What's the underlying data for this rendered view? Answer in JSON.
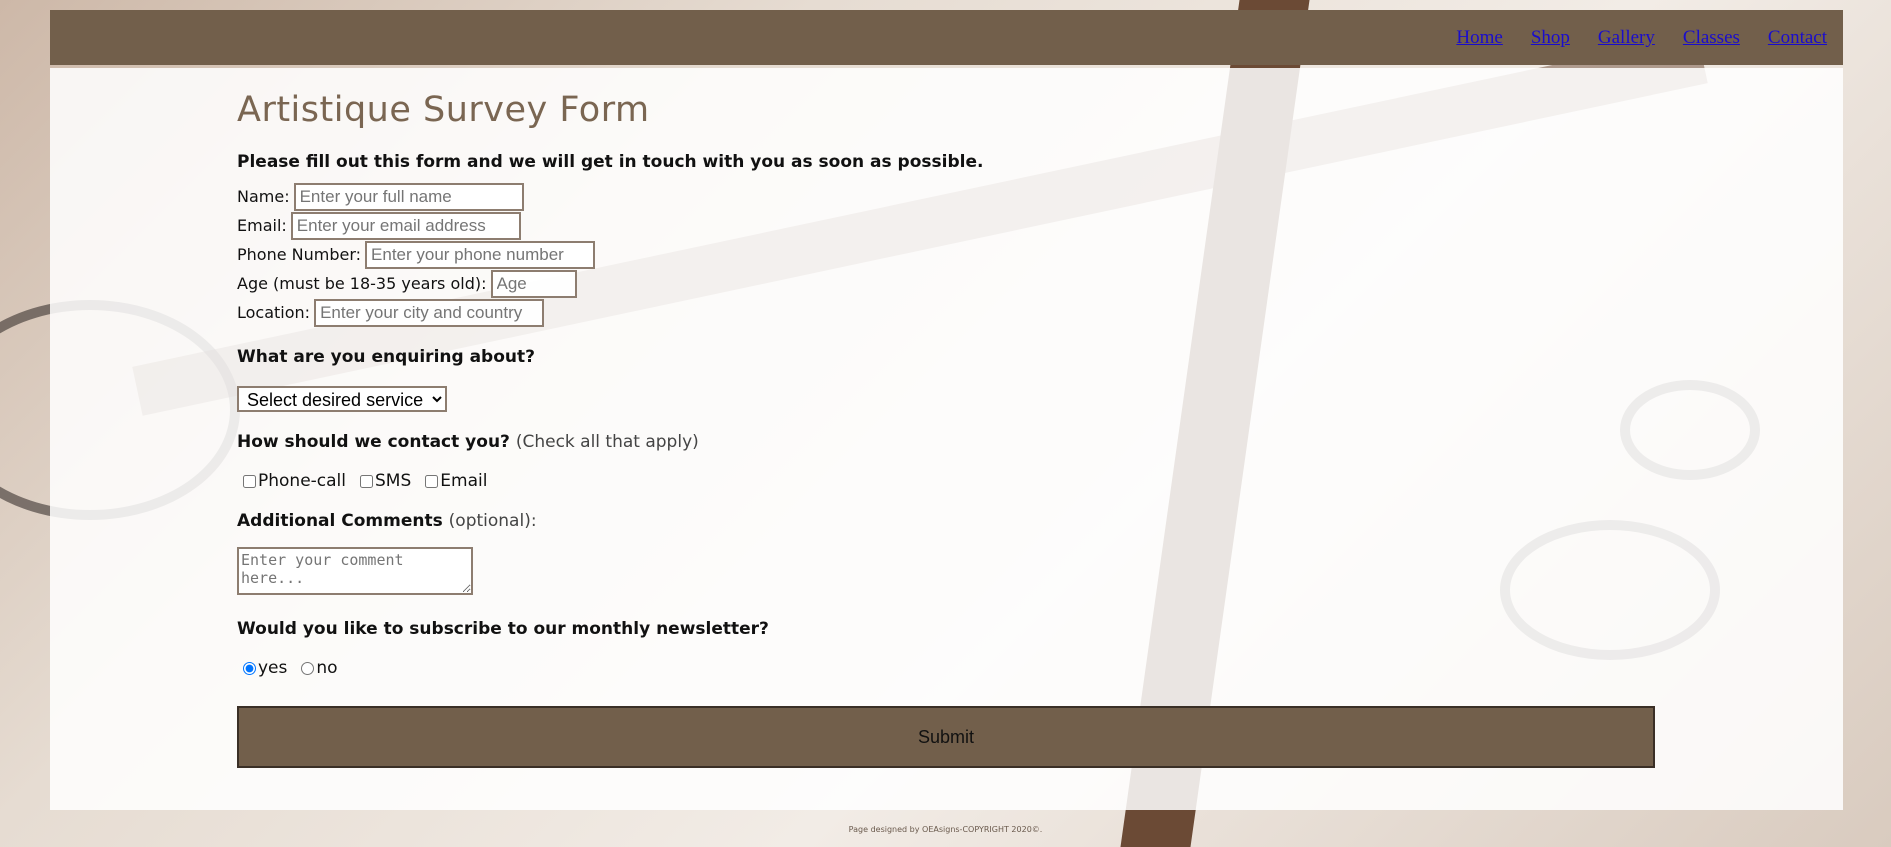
{
  "nav": {
    "items": [
      "Home",
      "Shop",
      "Gallery",
      "Classes",
      "Contact"
    ]
  },
  "form": {
    "title": "Artistique Survey Form",
    "intro": "Please fill out this form and we will get in touch with you as soon as possible.",
    "fields": [
      {
        "label": "Name:",
        "placeholder": "Enter your full name"
      },
      {
        "label": "Email:",
        "placeholder": "Enter your email address"
      },
      {
        "label": "Phone Number:",
        "placeholder": "Enter your phone number"
      },
      {
        "label": "Age (must be 18-35 years old):",
        "placeholder": "Age"
      },
      {
        "label": "Location:",
        "placeholder": "Enter your city and country"
      }
    ],
    "enquiry_question": "What are you enquiring about?",
    "service_select_value": "Select desired service",
    "contact_question": "How should we contact you?",
    "contact_note": "(Check all that apply)",
    "contact_options": [
      "Phone-call",
      "SMS",
      "Email"
    ],
    "comments_label": "Additional Comments",
    "comments_note": "(optional):",
    "comments_placeholder": "Enter your comment here...",
    "newsletter_question": "Would you like to subscribe to our monthly newsletter?",
    "newsletter_options": [
      "yes",
      "no"
    ],
    "newsletter_selected": "yes",
    "submit_label": "Submit"
  },
  "footer": {
    "text": "Page designed by OEAsigns-COPYRIGHT 2020©."
  },
  "colors": {
    "brand": "#725f4b",
    "title": "#7a6652"
  }
}
